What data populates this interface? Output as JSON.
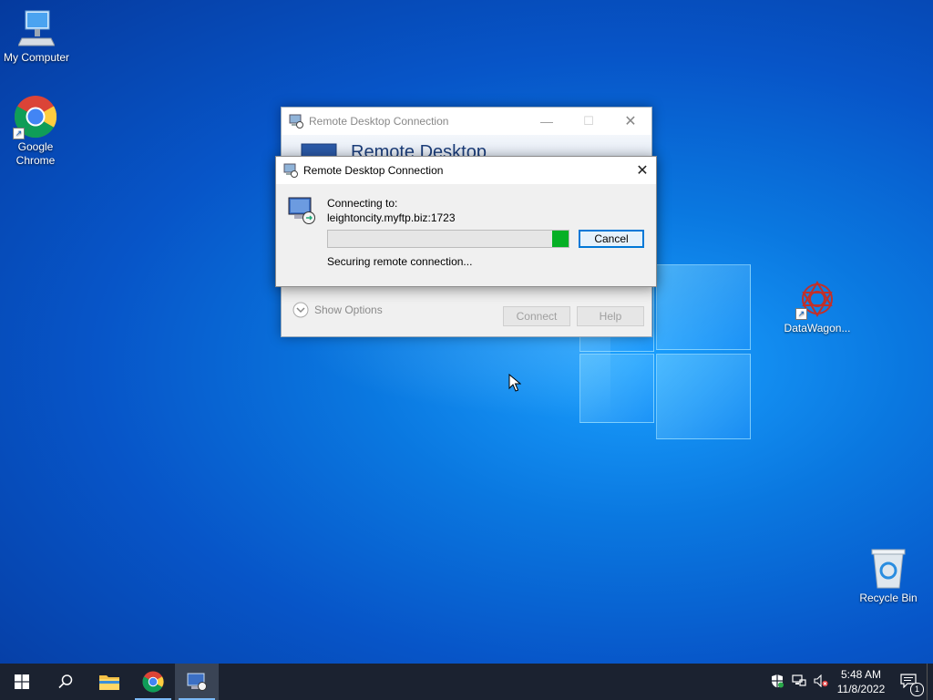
{
  "desktop": {
    "icons": [
      {
        "label": "My Computer"
      },
      {
        "label": "Google Chrome"
      },
      {
        "label": "DataWagon..."
      },
      {
        "label": "Recycle Bin"
      }
    ]
  },
  "bg_window": {
    "title": "Remote Desktop Connection",
    "banner_title": "Remote Desktop",
    "show_options": "Show Options",
    "connect": "Connect",
    "help": "Help"
  },
  "dialog": {
    "title": "Remote Desktop Connection",
    "connecting_label": "Connecting to:",
    "address": "leightoncity.myftp.biz:1723",
    "status": "Securing remote connection...",
    "cancel": "Cancel",
    "progress_fraction": 0.07
  },
  "taskbar": {
    "time": "5:48 AM",
    "date": "11/8/2022",
    "notification_count": "1"
  },
  "colors": {
    "progress_green": "#06b025",
    "accent": "#0078d7"
  }
}
